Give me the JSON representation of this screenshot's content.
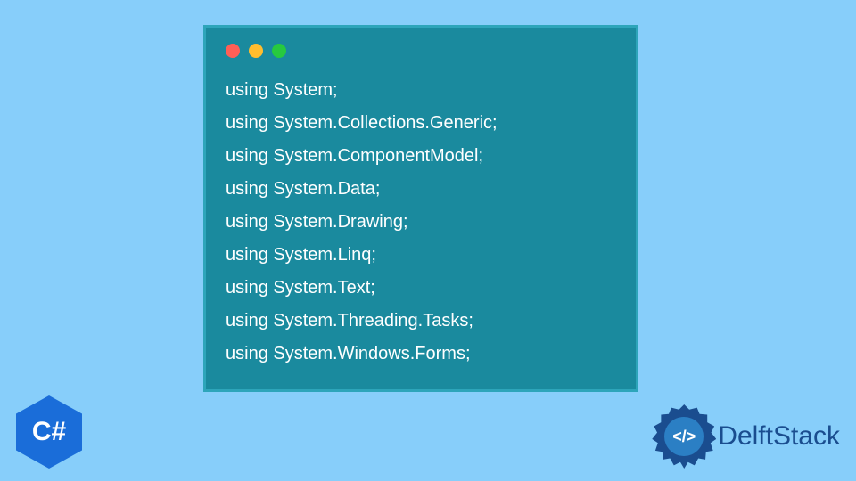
{
  "code": {
    "lines": [
      "using System;",
      "using System.Collections.Generic;",
      "using System.ComponentModel;",
      "using System.Data;",
      "using System.Drawing;",
      "using System.Linq;",
      "using System.Text;",
      "using System.Threading.Tasks;",
      "using System.Windows.Forms;"
    ]
  },
  "badge": {
    "csharp_label": "C#"
  },
  "brand": {
    "name": "DelftStack",
    "icon_glyph": "</>"
  }
}
